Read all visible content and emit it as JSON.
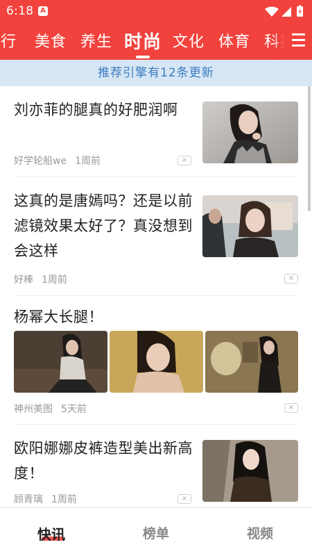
{
  "status_bar": {
    "time": "6:18",
    "app_indicator": "A"
  },
  "tabs": [
    {
      "label": "旅行"
    },
    {
      "label": "美食"
    },
    {
      "label": "养生"
    },
    {
      "label": "时尚",
      "active": true
    },
    {
      "label": "文化"
    },
    {
      "label": "体育"
    },
    {
      "label": "科技"
    }
  ],
  "menu_icon": "hamburger-menu-icon",
  "banner": {
    "text": "推荐引擎有12条更新"
  },
  "articles": [
    {
      "title": "刘亦菲的腿真的好肥润啊",
      "source": "好学轮船we",
      "time": "1周前",
      "close": "×"
    },
    {
      "title": "这真的是唐嫣吗？还是以前滤镜效果太好了？真没想到会这样",
      "source": "好棒",
      "time": "1周前",
      "close": "×"
    },
    {
      "title": "杨幂大长腿！",
      "source": "神州美图",
      "time": "5天前",
      "close": "×"
    },
    {
      "title": "欧阳娜娜皮裤造型美出新高度！",
      "source": "顾青璃",
      "time": "1周前",
      "close": "×"
    }
  ],
  "bottom_nav": [
    {
      "label": "快讯",
      "active": true
    },
    {
      "label": "榜单"
    },
    {
      "label": "视频"
    }
  ],
  "colors": {
    "brand": "#f2423d",
    "banner_bg": "#d6e6f4",
    "banner_text": "#3b7bbf"
  }
}
